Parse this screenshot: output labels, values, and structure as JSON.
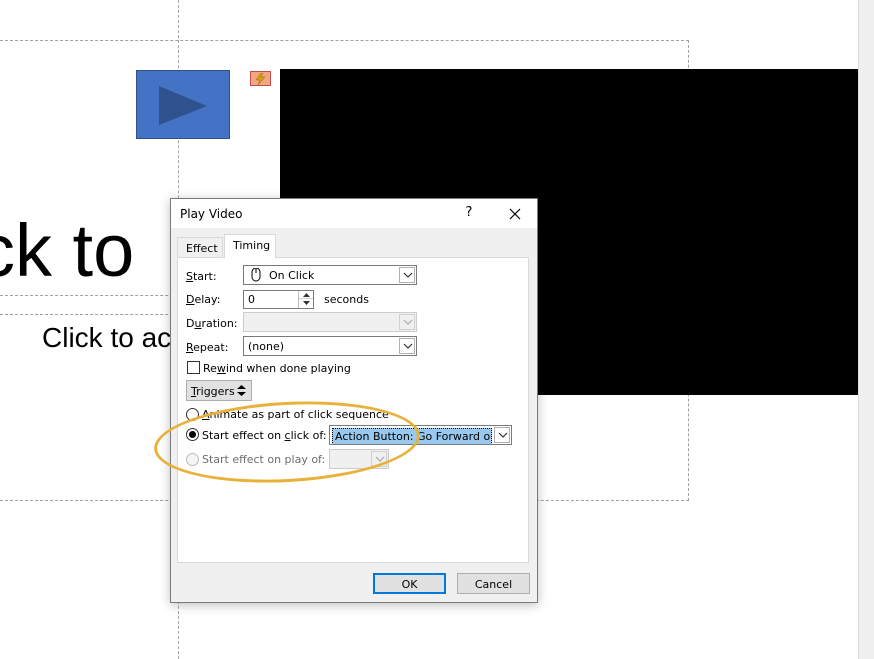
{
  "slide": {
    "title_text": "ck to",
    "body_text": "Click to ac"
  },
  "dialog": {
    "title": "Play Video",
    "help_glyph": "?",
    "tabs": [
      {
        "label": "Effect",
        "active": false
      },
      {
        "label": "Timing",
        "active": true
      }
    ],
    "start": {
      "label": "Start:",
      "label_mnemonic": "S",
      "label_rest": "tart:",
      "value": "On Click"
    },
    "delay": {
      "label_mnemonic": "D",
      "label_rest": "elay:",
      "value": "0",
      "unit": "seconds"
    },
    "duration": {
      "label_pre": "D",
      "label_mnemonic": "u",
      "label_rest": "ration:",
      "value": ""
    },
    "repeat": {
      "label_mnemonic": "R",
      "label_rest": "epeat:",
      "value": "(none)"
    },
    "rewind": {
      "label_pre": "Re",
      "label_mnemonic": "w",
      "label_rest": "ind when done playing",
      "checked": false
    },
    "triggers": {
      "label_mnemonic": "T",
      "label_rest": "riggers"
    },
    "trigger_options": {
      "animate": {
        "label_mnemonic": "A",
        "label_rest": "nimate as part of click sequence",
        "checked": false
      },
      "start_on_click": {
        "label_pre": "Start effect on ",
        "label_mnemonic": "c",
        "label_rest": "lick of:",
        "checked": true,
        "value": "Action Button: Go Forward or N"
      },
      "start_on_play": {
        "label": "Start effect on play of:",
        "checked": false,
        "enabled": false,
        "value": ""
      }
    },
    "ok_label": "OK",
    "cancel_label": "Cancel"
  },
  "colors": {
    "action_button": "#4472c4",
    "video_placeholder": "#000000",
    "highlight_ring": "#e8b23a",
    "selection": "#99c9ef"
  }
}
